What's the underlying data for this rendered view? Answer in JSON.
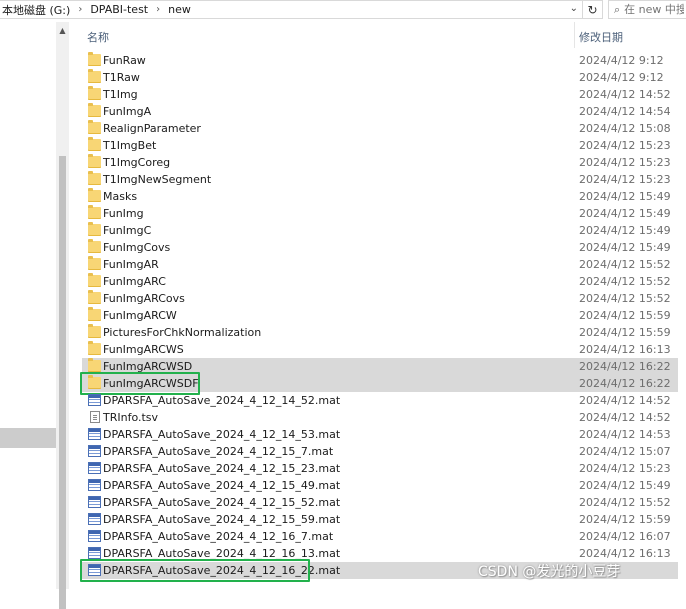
{
  "address_bar": {
    "crumbs": [
      "本地磁盘 (G:)",
      "DPABI-test",
      "new"
    ],
    "separator": "›"
  },
  "search": {
    "placeholder": "在 new 中搜索"
  },
  "columns": {
    "name": "名称",
    "date_modified": "修改日期"
  },
  "files": [
    {
      "name": "FunRaw",
      "date": "2024/4/12 9:12",
      "type": "folder"
    },
    {
      "name": "T1Raw",
      "date": "2024/4/12 9:12",
      "type": "folder"
    },
    {
      "name": "T1Img",
      "date": "2024/4/12 14:52",
      "type": "folder"
    },
    {
      "name": "FunImgA",
      "date": "2024/4/12 14:54",
      "type": "folder"
    },
    {
      "name": "RealignParameter",
      "date": "2024/4/12 15:08",
      "type": "folder"
    },
    {
      "name": "T1ImgBet",
      "date": "2024/4/12 15:23",
      "type": "folder"
    },
    {
      "name": "T1ImgCoreg",
      "date": "2024/4/12 15:23",
      "type": "folder"
    },
    {
      "name": "T1ImgNewSegment",
      "date": "2024/4/12 15:23",
      "type": "folder"
    },
    {
      "name": "Masks",
      "date": "2024/4/12 15:49",
      "type": "folder"
    },
    {
      "name": "FunImg",
      "date": "2024/4/12 15:49",
      "type": "folder"
    },
    {
      "name": "FunImgC",
      "date": "2024/4/12 15:49",
      "type": "folder"
    },
    {
      "name": "FunImgCovs",
      "date": "2024/4/12 15:49",
      "type": "folder"
    },
    {
      "name": "FunImgAR",
      "date": "2024/4/12 15:52",
      "type": "folder"
    },
    {
      "name": "FunImgARC",
      "date": "2024/4/12 15:52",
      "type": "folder"
    },
    {
      "name": "FunImgARCovs",
      "date": "2024/4/12 15:52",
      "type": "folder"
    },
    {
      "name": "FunImgARCW",
      "date": "2024/4/12 15:59",
      "type": "folder"
    },
    {
      "name": "PicturesForChkNormalization",
      "date": "2024/4/12 15:59",
      "type": "folder"
    },
    {
      "name": "FunImgARCWS",
      "date": "2024/4/12 16:13",
      "type": "folder"
    },
    {
      "name": "FunImgARCWSD",
      "date": "2024/4/12 16:22",
      "type": "folder",
      "selected": true
    },
    {
      "name": "FunImgARCWSDF",
      "date": "2024/4/12 16:22",
      "type": "folder",
      "selected": true,
      "highlighted": true
    },
    {
      "name": "DPARSFA_AutoSave_2024_4_12_14_52.mat",
      "date": "2024/4/12 14:52",
      "type": "mat"
    },
    {
      "name": "TRInfo.tsv",
      "date": "2024/4/12 14:52",
      "type": "txt"
    },
    {
      "name": "DPARSFA_AutoSave_2024_4_12_14_53.mat",
      "date": "2024/4/12 14:53",
      "type": "mat"
    },
    {
      "name": "DPARSFA_AutoSave_2024_4_12_15_7.mat",
      "date": "2024/4/12 15:07",
      "type": "mat"
    },
    {
      "name": "DPARSFA_AutoSave_2024_4_12_15_23.mat",
      "date": "2024/4/12 15:23",
      "type": "mat"
    },
    {
      "name": "DPARSFA_AutoSave_2024_4_12_15_49.mat",
      "date": "2024/4/12 15:49",
      "type": "mat"
    },
    {
      "name": "DPARSFA_AutoSave_2024_4_12_15_52.mat",
      "date": "2024/4/12 15:52",
      "type": "mat"
    },
    {
      "name": "DPARSFA_AutoSave_2024_4_12_15_59.mat",
      "date": "2024/4/12 15:59",
      "type": "mat"
    },
    {
      "name": "DPARSFA_AutoSave_2024_4_12_16_7.mat",
      "date": "2024/4/12 16:07",
      "type": "mat"
    },
    {
      "name": "DPARSFA_AutoSave_2024_4_12_16_13.mat",
      "date": "2024/4/12 16:13",
      "type": "mat"
    },
    {
      "name": "DPARSFA_AutoSave_2024_4_12_16_22.mat",
      "date": "",
      "type": "mat",
      "selected": true,
      "highlighted": true
    }
  ],
  "watermark": "CSDN @发光的小豆芽",
  "colors": {
    "selection": "#d9d9d9",
    "highlight_box": "#22b14c",
    "folder": "#f8d675"
  }
}
